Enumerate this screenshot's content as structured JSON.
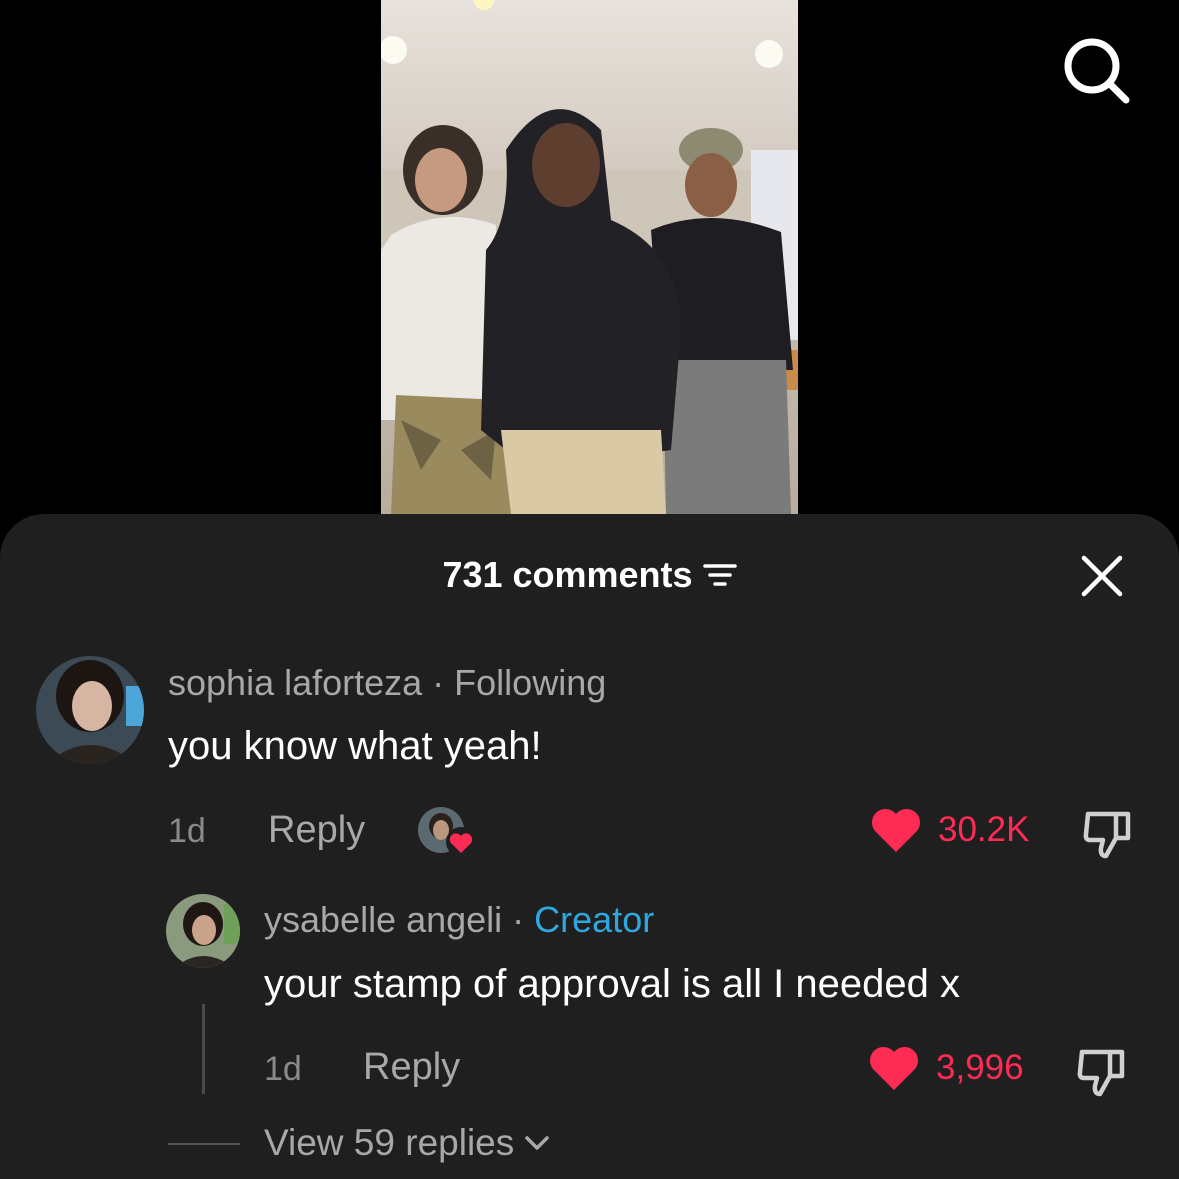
{
  "comments_header": {
    "count_label": "731 comments"
  },
  "comments": [
    {
      "username": "sophia laforteza",
      "separator": " · ",
      "tag": "Following",
      "text": "you know what yeah!",
      "age": "1d",
      "reply_label": "Reply",
      "likes": "30.2K",
      "liked": true,
      "creator_liked": true
    }
  ],
  "replies": [
    {
      "username": "ysabelle angeli",
      "separator": " · ",
      "tag": "Creator",
      "text": "your stamp of approval is all I needed x",
      "age": "1d",
      "reply_label": "Reply",
      "likes": "3,996",
      "liked": true
    }
  ],
  "view_replies_label": "View 59 replies",
  "colors": {
    "sheet_bg": "#1f1f1f",
    "like_red": "#fe2c55",
    "creator_blue": "#2fa8e0",
    "muted": "#a8a8a8"
  },
  "icons": [
    "search-icon",
    "filter-icon",
    "close-icon",
    "heart-icon",
    "dislike-icon",
    "chevron-down-icon"
  ]
}
